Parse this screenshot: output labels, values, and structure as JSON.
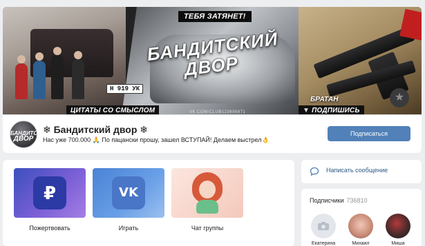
{
  "cover": {
    "pull_text": "ТЕБЯ ЗАТЯНЕТ!",
    "logo_line1": "БАНДИТСКИЙ",
    "logo_line2": "ДВОР",
    "plate": "Н 919 УК",
    "url": "VK.COM/CLUB123656871",
    "quotes_tag": "ЦИТАТЫ СО СМЫСЛОМ",
    "brat_tag": "БРАТАН",
    "subscribe_tag": "ПОДПИШИСЬ",
    "star_glyph": "★"
  },
  "group": {
    "avatar_line1": "БАНДИТСКИЙ",
    "avatar_line2": "ДВОР",
    "name": "❄ Бандитский двор ❄",
    "status": "Нас уже 700.000 🙏 По пацански прошу, зашел ВСТУПАЙ! Делаем выстрел👌",
    "subscribe_label": "Подписаться",
    "accent_color": "#5181b8"
  },
  "apps": [
    {
      "label": "Пожертвовать",
      "icon": "ruble-icon",
      "glyph": "₽"
    },
    {
      "label": "Играть",
      "icon": "vk-icon",
      "glyph": "VK"
    },
    {
      "label": "Чат группы",
      "icon": "chat-avatar-icon"
    }
  ],
  "message": {
    "label": "Написать сообщение",
    "icon": "speech-bubble-icon"
  },
  "subscribers": {
    "title": "Подписчики",
    "count": "736810",
    "members": [
      {
        "name": "Екатерина",
        "icon": "camera-icon"
      },
      {
        "name": "Михаил"
      },
      {
        "name": "Миша"
      }
    ]
  }
}
